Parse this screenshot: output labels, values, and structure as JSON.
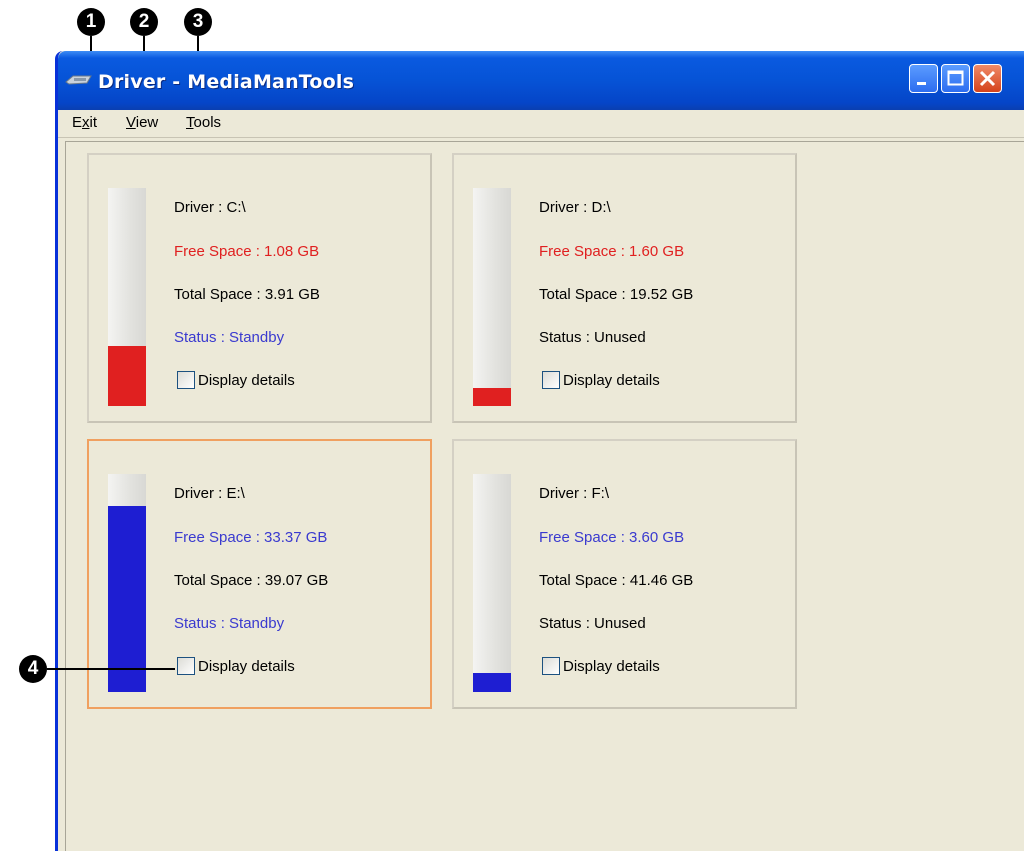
{
  "window": {
    "title": "Driver - MediaManTools"
  },
  "menu": {
    "items": [
      {
        "label": "Exit",
        "mnemonic_index": 1
      },
      {
        "label": "View",
        "mnemonic_index": 0
      },
      {
        "label": "Tools",
        "mnemonic_index": 0
      }
    ]
  },
  "callouts": [
    "1",
    "2",
    "3",
    "4"
  ],
  "colors": {
    "used_fill_low": "#e02020",
    "used_fill_ok": "#1e1ed2",
    "text_red": "#e02020",
    "text_blue": "#3a3acf",
    "selected_border": "#f0a060"
  },
  "drives": [
    {
      "driver": "Driver : C:\\",
      "free": "Free Space : 1.08 GB",
      "total": "Total Space : 3.91 GB",
      "status": "Status : Standby",
      "checkbox_label": "Display details",
      "checked": false,
      "free_ratio": 0.276,
      "tone": "red",
      "status_tone": "blue",
      "selected": false
    },
    {
      "driver": "Driver : D:\\",
      "free": "Free Space : 1.60 GB",
      "total": "Total Space : 19.52 GB",
      "status": "Status : Unused",
      "checkbox_label": "Display details",
      "checked": false,
      "free_ratio": 0.082,
      "tone": "red",
      "status_tone": "black",
      "selected": false
    },
    {
      "driver": "Driver : E:\\",
      "free": "Free Space : 33.37 GB",
      "total": "Total Space : 39.07 GB",
      "status": "Status : Standby",
      "checkbox_label": "Display details",
      "checked": false,
      "free_ratio": 0.854,
      "tone": "blue",
      "status_tone": "blue",
      "selected": true
    },
    {
      "driver": "Driver : F:\\",
      "free": "Free Space : 3.60 GB",
      "total": "Total Space : 41.46 GB",
      "status": "Status : Unused",
      "checkbox_label": "Display details",
      "checked": false,
      "free_ratio": 0.087,
      "tone": "blue",
      "status_tone": "black",
      "selected": false
    }
  ]
}
